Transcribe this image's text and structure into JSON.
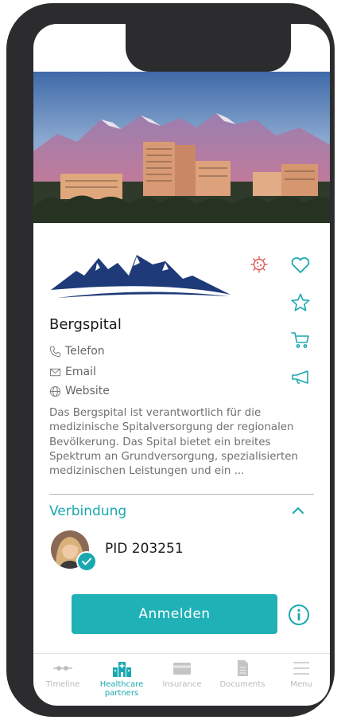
{
  "colors": {
    "accent": "#1aa8b0",
    "button": "#1fb1b6",
    "virus": "#e05a5a",
    "logo_navy": "#1e3a78"
  },
  "hospital": {
    "name": "Bergspital",
    "contacts": [
      {
        "icon": "phone-icon",
        "label": "Telefon"
      },
      {
        "icon": "mail-icon",
        "label": "Email"
      },
      {
        "icon": "globe-icon",
        "label": "Website"
      }
    ],
    "description": "Das Bergspital ist verantwortlich für die medizinische Spitalversorgung der regionalen Bevölkerung. Das Spital bietet ein breites Spektrum an Grundversorgung, spezialisierten medizinischen Leistungen und ein ..."
  },
  "side_actions": [
    "heart-icon",
    "star-icon",
    "cart-icon",
    "megaphone-icon"
  ],
  "connection": {
    "title": "Verbindung",
    "pid": "PID 203251"
  },
  "login_label": "Anmelden",
  "tabs": [
    {
      "label": "Timeline",
      "icon": "timeline-icon",
      "active": false
    },
    {
      "label": "Healthcare partners",
      "icon": "hospital-icon",
      "active": true
    },
    {
      "label": "Insurance",
      "icon": "card-icon",
      "active": false
    },
    {
      "label": "Documents",
      "icon": "document-icon",
      "active": false
    },
    {
      "label": "Menu",
      "icon": "menu-icon",
      "active": false
    }
  ]
}
